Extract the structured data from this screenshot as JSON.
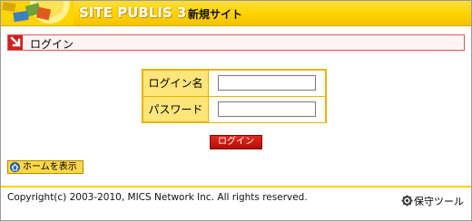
{
  "header": {
    "brand": "SITE PUBLIS 3",
    "site_name": "新規サイト"
  },
  "title_bar": {
    "label": "ログイン"
  },
  "login_form": {
    "login_name_label": "ログイン名",
    "login_name_value": "",
    "password_label": "パスワード",
    "password_value": "",
    "submit_label": "ログイン"
  },
  "home_button": {
    "label": "ホームを表示"
  },
  "footer": {
    "copyright": "Copyright(c) 2003-2010, MICS Network Inc. All rights reserved.",
    "tool_link": "保守ツール"
  },
  "colors": {
    "header_yellow": "#ffd200",
    "accent_red": "#d12020",
    "table_yellow": "#ffe57a"
  },
  "icons": [
    "logo-graphic",
    "arrow-down-right-icon",
    "home-icon",
    "maintenance-tool-icon"
  ]
}
